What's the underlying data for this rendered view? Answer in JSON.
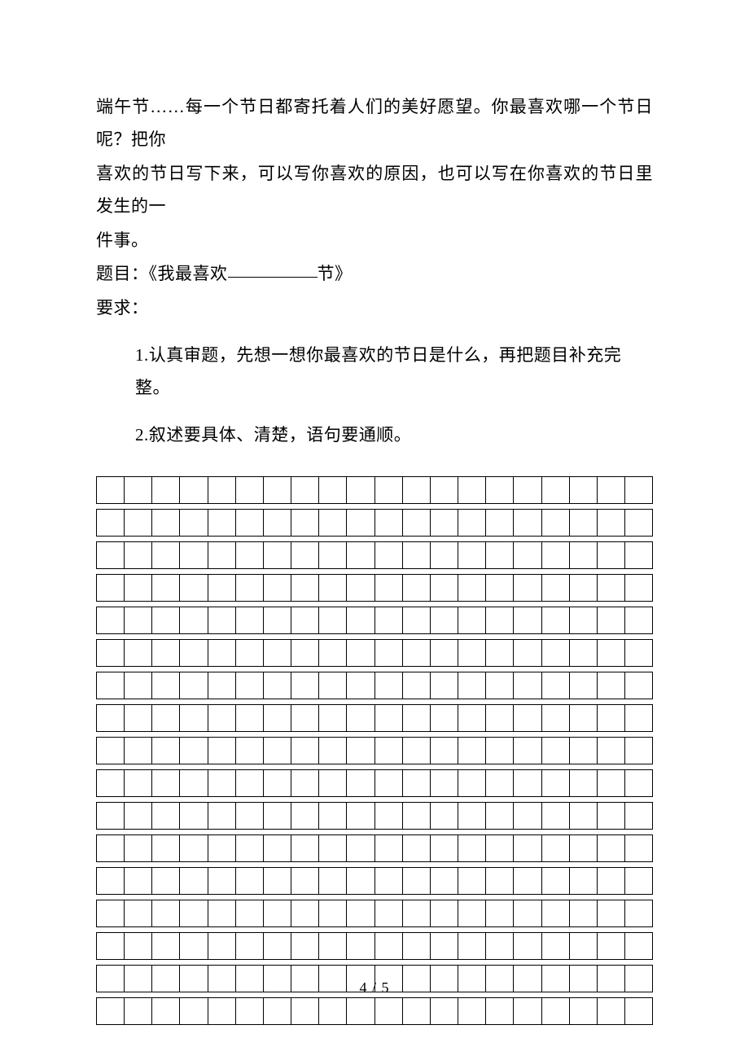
{
  "prompt": {
    "line1": "端午节……每一个节日都寄托着人们的美好愿望。你最喜欢哪一个节日呢？把你",
    "line2": "喜欢的节日写下来，可以写你喜欢的原因，也可以写在你喜欢的节日里发生的一",
    "line3": "件事。"
  },
  "title": {
    "label_prefix": "题目：《我最喜欢",
    "label_suffix": "节》"
  },
  "requirements": {
    "label": "要求：",
    "items": [
      "1.认真审题，先想一想你最喜欢的节日是什么，再把题目补充完整。",
      "2.叙述要具体、清楚，语句要通顺。"
    ]
  },
  "grid": {
    "rows": 17,
    "cols": 20
  },
  "footer": {
    "page_current": "4",
    "page_sep": " / ",
    "page_total": "5"
  }
}
